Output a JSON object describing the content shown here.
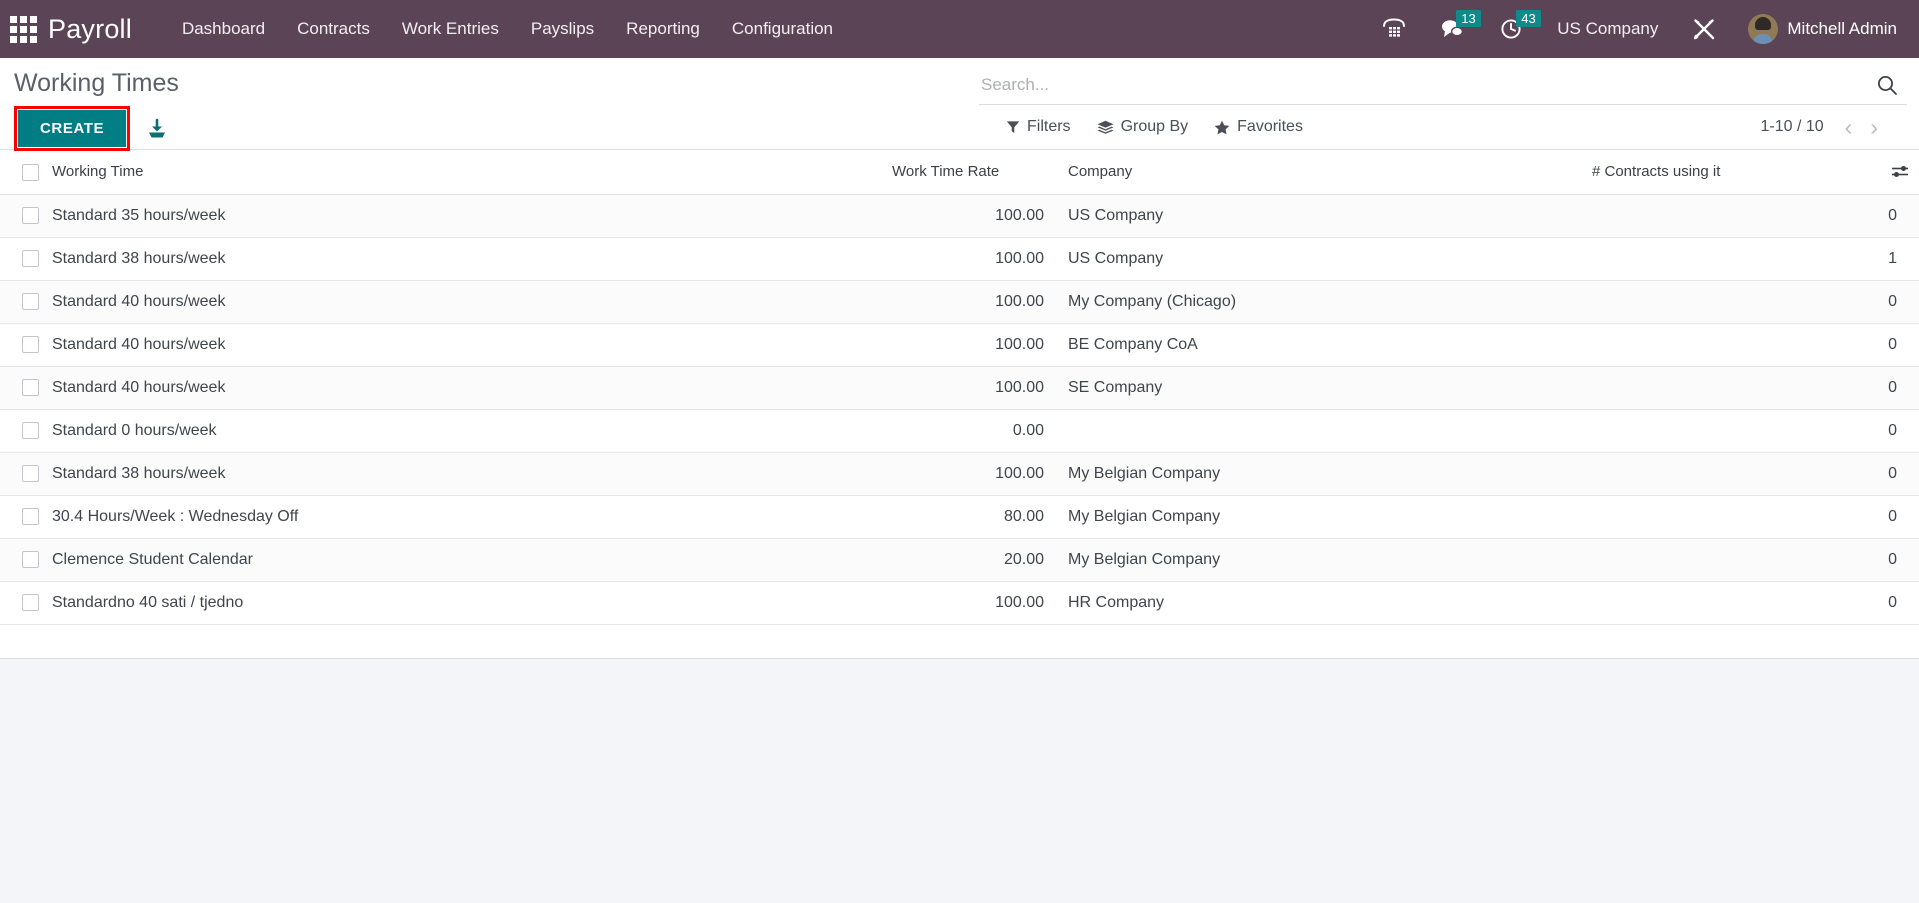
{
  "navbar": {
    "apps_icon": "apps-grid-icon",
    "brand": "Payroll",
    "menu": [
      {
        "label": "Dashboard"
      },
      {
        "label": "Contracts"
      },
      {
        "label": "Work Entries"
      },
      {
        "label": "Payslips"
      },
      {
        "label": "Reporting"
      },
      {
        "label": "Configuration"
      }
    ],
    "phone_icon": "voip-phone-icon",
    "messages_icon": "chat-bubble-icon",
    "messages_count": "13",
    "activities_icon": "clock-icon",
    "activities_count": "43",
    "company": "US Company",
    "debug_icon": "tools-wrench-icon",
    "user_name": "Mitchell Admin",
    "avatar_icon": "user-avatar",
    "bg_color": "#5c4457",
    "badge_color": "#0e8a8a"
  },
  "control_panel": {
    "title": "Working Times",
    "create_label": "CREATE",
    "create_color": "#017e84",
    "highlight_color": "#ff0000",
    "import_icon": "import-download-icon",
    "search": {
      "placeholder": "Search...",
      "value": "",
      "icon": "search-icon"
    },
    "filters_label": "Filters",
    "filters_icon": "filter-funnel-icon",
    "groupby_label": "Group By",
    "groupby_icon": "layers-icon",
    "favorites_label": "Favorites",
    "favorites_icon": "star-icon",
    "pager_text": "1-10 / 10",
    "pager_prev_icon": "chevron-left-icon",
    "pager_next_icon": "chevron-right-icon"
  },
  "table": {
    "columns": {
      "working_time": "Working Time",
      "work_time_rate": "Work Time Rate",
      "company": "Company",
      "contracts": "# Contracts using it"
    },
    "optional_columns_icon": "column-options-icon",
    "select_all_checkbox": "select-all-checkbox",
    "rows": [
      {
        "name": "Standard 35 hours/week",
        "rate": "100.00",
        "company": "US Company",
        "contracts": "0"
      },
      {
        "name": "Standard 38 hours/week",
        "rate": "100.00",
        "company": "US Company",
        "contracts": "1"
      },
      {
        "name": "Standard 40 hours/week",
        "rate": "100.00",
        "company": "My Company (Chicago)",
        "contracts": "0"
      },
      {
        "name": "Standard 40 hours/week",
        "rate": "100.00",
        "company": "BE Company CoA",
        "contracts": "0"
      },
      {
        "name": "Standard 40 hours/week",
        "rate": "100.00",
        "company": "SE Company",
        "contracts": "0"
      },
      {
        "name": "Standard 0 hours/week",
        "rate": "0.00",
        "company": "",
        "contracts": "0"
      },
      {
        "name": "Standard 38 hours/week",
        "rate": "100.00",
        "company": "My Belgian Company",
        "contracts": "0"
      },
      {
        "name": "30.4 Hours/Week : Wednesday Off",
        "rate": "80.00",
        "company": "My Belgian Company",
        "contracts": "0"
      },
      {
        "name": "Clemence Student Calendar",
        "rate": "20.00",
        "company": "My Belgian Company",
        "contracts": "0"
      },
      {
        "name": "Standardno 40 sati / tjedno",
        "rate": "100.00",
        "company": "HR Company",
        "contracts": "0"
      }
    ]
  }
}
